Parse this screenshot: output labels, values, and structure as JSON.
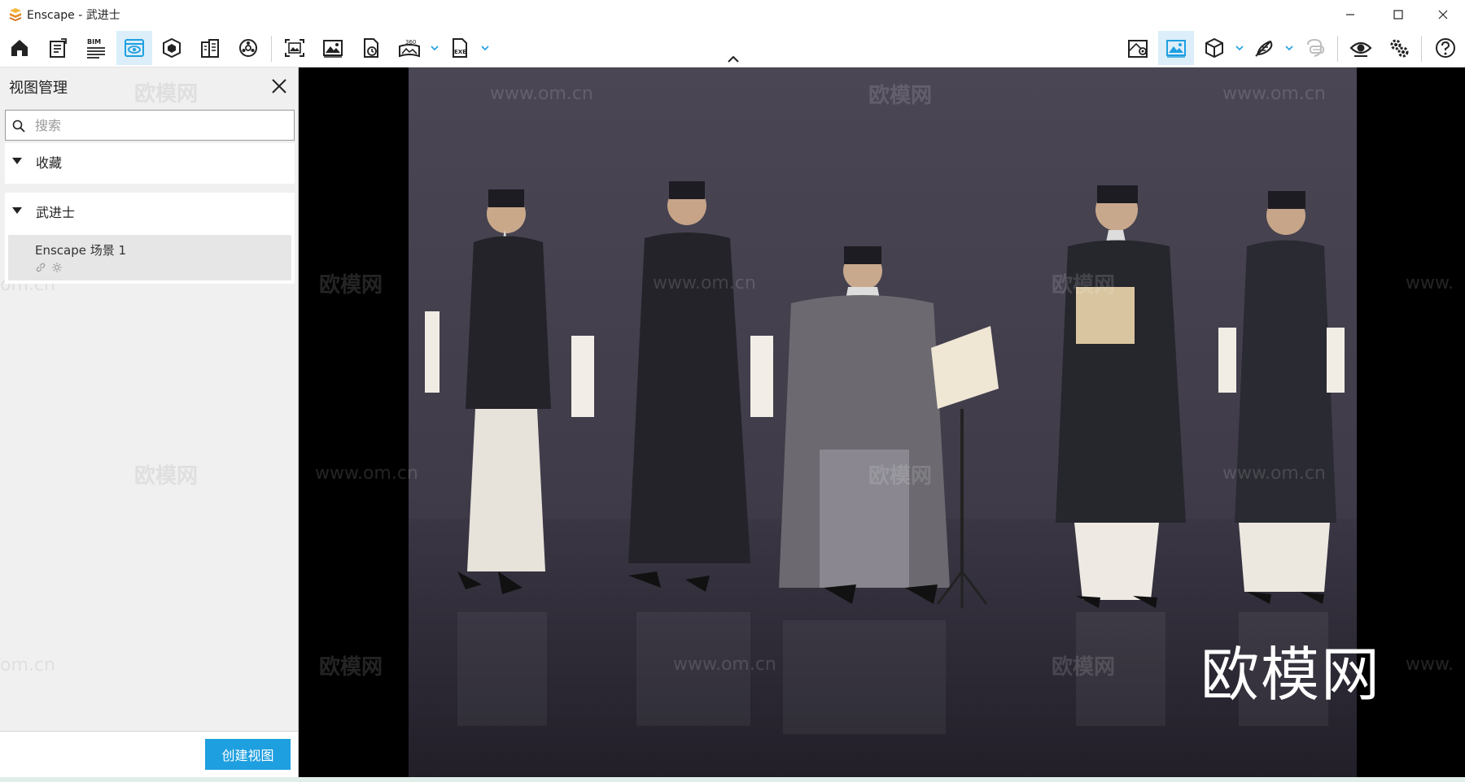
{
  "window": {
    "title": "Enscape - 武进士",
    "logo_color": "#f0a030"
  },
  "toolbar": {
    "left_icons": [
      "home-icon",
      "notes-icon",
      "bim-icon",
      "views-icon",
      "material-icon",
      "building-icon",
      "asset-library-icon",
      "screenshot-icon",
      "image-export-icon",
      "batch-render-icon",
      "panorama-360-icon",
      "exe-export-icon"
    ],
    "bim_label": "BIM",
    "pano_label": "360",
    "exe_label": "EXE",
    "right_icons": [
      "map-pin-icon",
      "image-view-icon",
      "cube-icon",
      "feather-icon",
      "vr-headset-icon",
      "eye-icon",
      "settings-icon",
      "help-icon"
    ],
    "accent_color": "#1e9fe0"
  },
  "panel": {
    "title": "视图管理",
    "search_placeholder": "搜索",
    "favorites_label": "收藏",
    "group_label": "武进士",
    "view_item": "Enscape 场景 1",
    "create_button": "创建视图"
  },
  "viewport": {
    "brand_text": "欧模网",
    "watermark_text": "欧模网",
    "watermark_url": "www.om.cn",
    "watermark_fragment": "om.cn",
    "watermark_url_fragment": "www."
  }
}
